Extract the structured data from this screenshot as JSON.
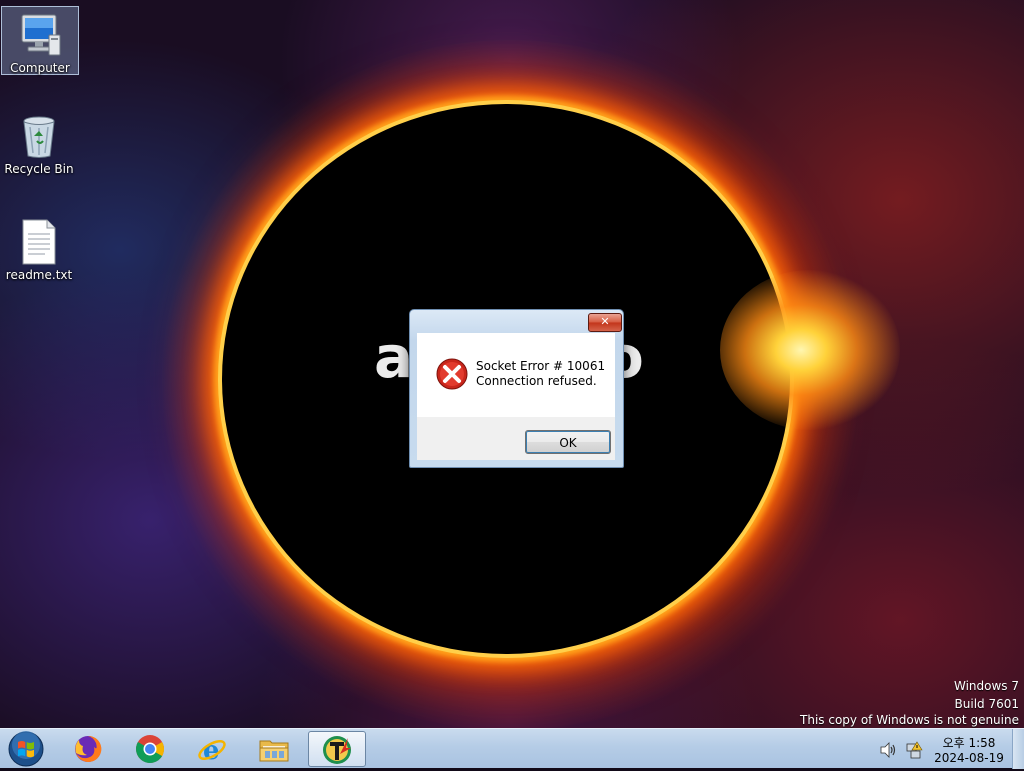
{
  "wallpaper": {
    "text_left": "a",
    "text_right": "o"
  },
  "desktop_icons": [
    {
      "label": "Computer",
      "icon": "computer-icon",
      "selected": true
    },
    {
      "label": "Recycle Bin",
      "icon": "recycle-bin-icon",
      "selected": false
    },
    {
      "label": "readme.txt",
      "icon": "text-file-icon",
      "selected": false
    }
  ],
  "dialog": {
    "title": "",
    "close_label": "✕",
    "icon": "error-icon",
    "message_line1": "Socket Error # 10061",
    "message_line2": "Connection refused.",
    "ok_label": "OK"
  },
  "watermark": {
    "line1": "Windows 7",
    "line2": "Build 7601",
    "line3": "This copy of Windows is not genuine"
  },
  "taskbar": {
    "start_icon": "windows-start-icon",
    "pinned": [
      {
        "name": "Firefox",
        "icon": "firefox-icon"
      },
      {
        "name": "Chrome",
        "icon": "chrome-icon"
      },
      {
        "name": "Internet Explorer",
        "icon": "internet-explorer-icon"
      },
      {
        "name": "Windows Explorer",
        "icon": "folder-icon"
      },
      {
        "name": "Application",
        "icon": "app-icon",
        "active": true
      }
    ],
    "tray": {
      "volume_icon": "speaker-icon",
      "network_icon": "network-icon",
      "time": "오후 1:58",
      "date": "2024-08-19"
    }
  },
  "colors": {
    "taskbar": "#b5cce6",
    "dialog_frame": "#c3d7ec",
    "close_button": "#c2341a",
    "error_red": "#c8261b"
  }
}
